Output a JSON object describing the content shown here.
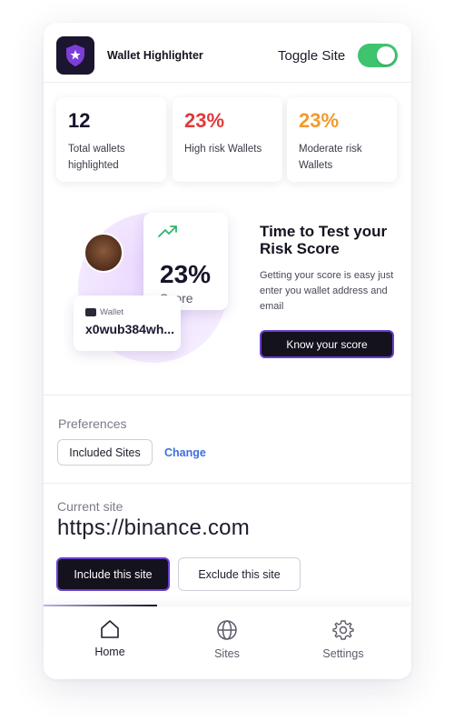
{
  "header": {
    "app_name": "Wallet Highlighter",
    "toggle_label": "Toggle Site",
    "toggle_on": true,
    "logo_icon": "shield-icon"
  },
  "stats": [
    {
      "value": "12",
      "label": "Total wallets highlighted",
      "color": "#16142a"
    },
    {
      "value": "23%",
      "label": "High risk Wallets",
      "color": "#e03a3a"
    },
    {
      "value": "23%",
      "label": "Moderate risk Wallets",
      "color": "#f29a2e"
    }
  ],
  "promo": {
    "score_value": "23%",
    "score_label": "Score",
    "trend_icon": "trending-up-icon",
    "wallet_label": "Wallet",
    "wallet_address": "x0wub384wh...",
    "title": "Time to Test your Risk Score",
    "text": "Getting your score is easy just enter you wallet address and email",
    "button_label": "Know your score"
  },
  "preferences": {
    "title": "Preferences",
    "pill_label": "Included Sites",
    "change_label": "Change"
  },
  "current_site": {
    "title": "Current site",
    "url": "https://binance.com",
    "include_label": "Include this site",
    "exclude_label": "Exclude this site"
  },
  "nav": [
    {
      "label": "Home",
      "icon": "home-icon",
      "active": true
    },
    {
      "label": "Sites",
      "icon": "globe-icon",
      "active": false
    },
    {
      "label": "Settings",
      "icon": "gear-icon",
      "active": false
    }
  ],
  "colors": {
    "accent": "#6a3fd0",
    "toggle_on": "#3ec46d",
    "link": "#3d6fe0",
    "dark": "#14121c"
  }
}
